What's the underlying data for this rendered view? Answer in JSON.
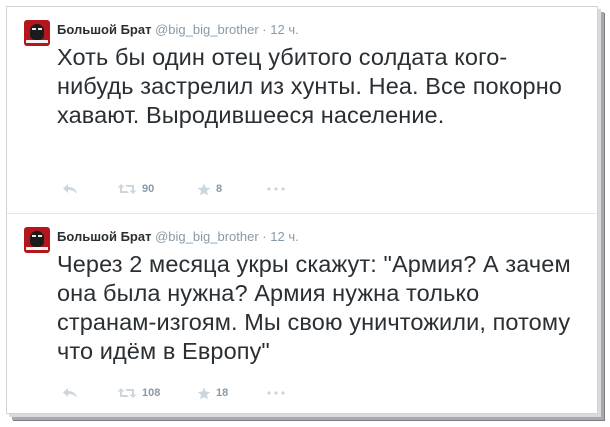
{
  "tweets": [
    {
      "author_name": "Большой Брат",
      "handle": "@big_big_brother",
      "separator": "·",
      "time": "12 ч.",
      "text": "Хоть бы один отец убитого солдата кого-нибудь застрелил из хунты. Неа. Все покорно хавают. Выродившееся население.",
      "retweets": "90",
      "favorites": "8"
    },
    {
      "author_name": "Большой Брат",
      "handle": "@big_big_brother",
      "separator": "·",
      "time": "12 ч.",
      "text": "Через 2 месяца укры скажут: \"Армия? А зачем она была нужна? Армия нужна только странам-изгоям. Мы свою уничтожили, потому что идём в Европу\"",
      "retweets": "108",
      "favorites": "18"
    }
  ],
  "icons": {
    "reply": "reply-icon",
    "retweet": "retweet-icon",
    "favorite": "star-icon",
    "more": "more-icon"
  },
  "colors": {
    "text": "#292f33",
    "meta": "#8899a6",
    "avatar": "#b3161c"
  }
}
